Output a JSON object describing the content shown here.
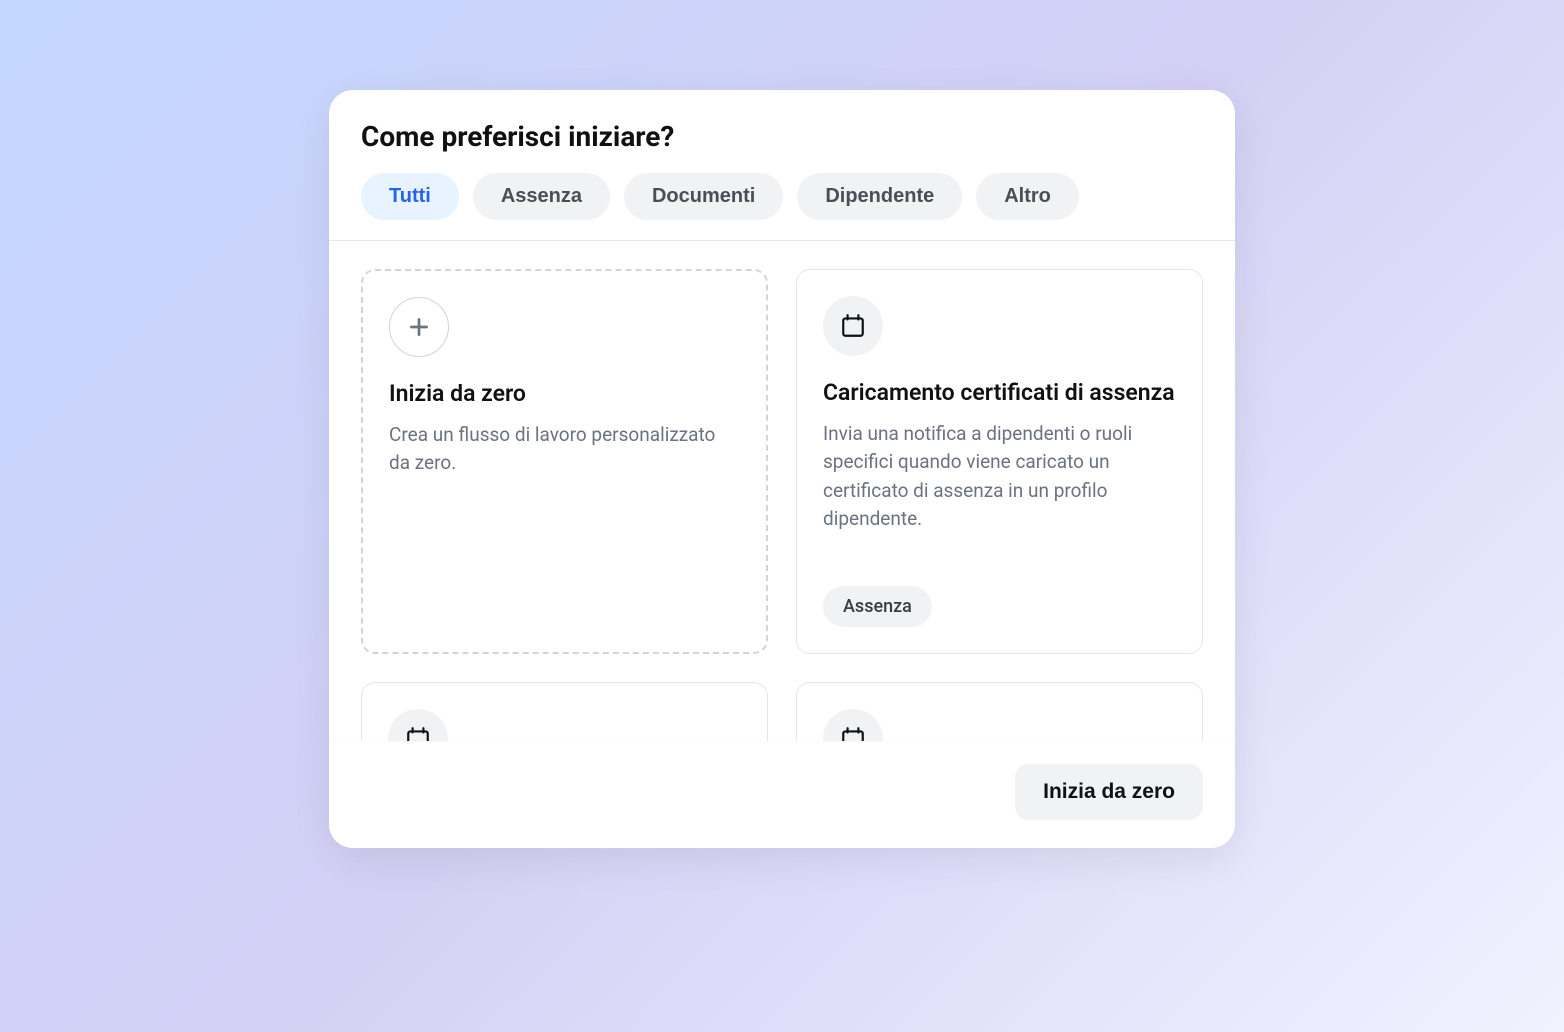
{
  "modal": {
    "title": "Come preferisci iniziare?",
    "tabs": [
      {
        "label": "Tutti",
        "active": true
      },
      {
        "label": "Assenza",
        "active": false
      },
      {
        "label": "Documenti",
        "active": false
      },
      {
        "label": "Dipendente",
        "active": false
      },
      {
        "label": "Altro",
        "active": false
      }
    ],
    "cards": [
      {
        "type": "scratch",
        "title": "Inizia da zero",
        "description": "Crea un flusso di lavoro personalizzato da zero."
      },
      {
        "type": "template",
        "title": "Caricamento certificati di assenza",
        "description": "Invia una notifica a dipendenti o ruoli specifici quando viene caricato un certificato di assenza in un profilo dipendente.",
        "tag": "Assenza"
      }
    ],
    "footer": {
      "button_label": "Inizia da zero"
    }
  }
}
